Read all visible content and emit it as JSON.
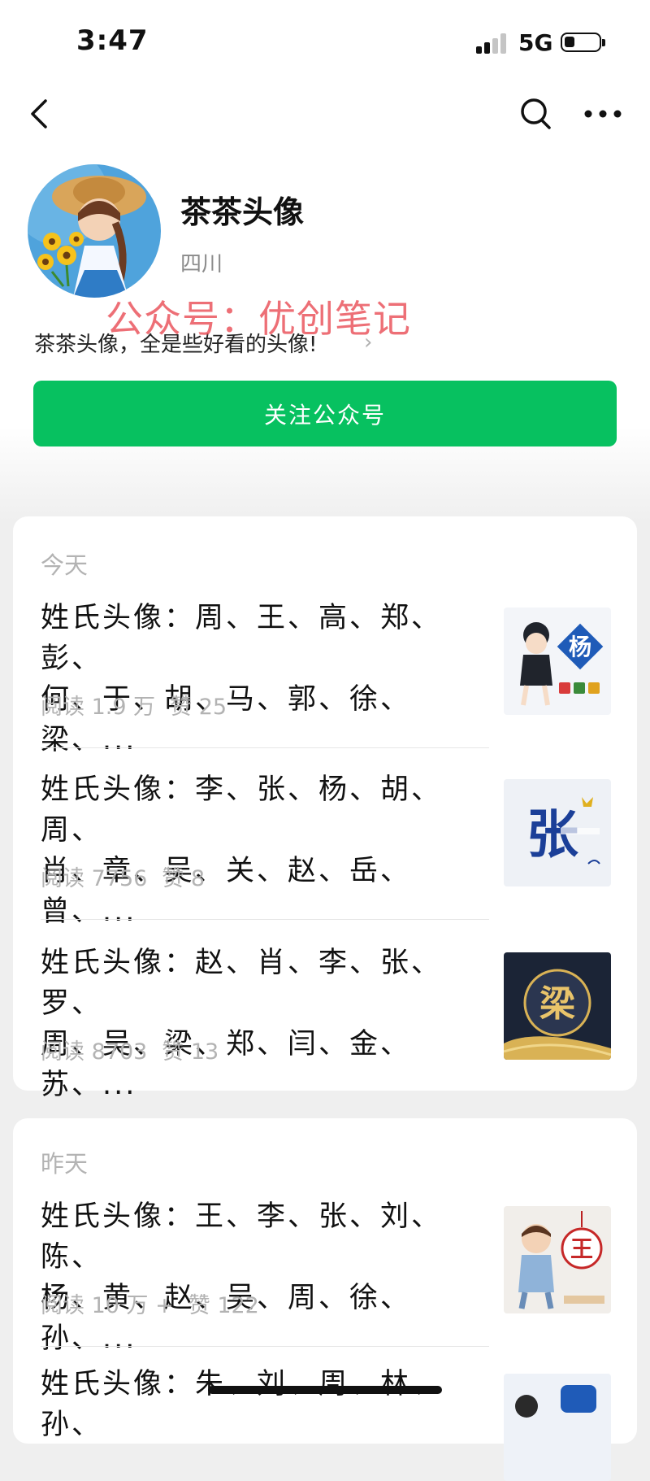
{
  "status_bar": {
    "time": "3:47",
    "network": "5G"
  },
  "nav": {
    "back_icon": "chevron-left-icon",
    "search_icon": "search-icon",
    "more_icon": "more-dots-icon"
  },
  "account": {
    "name": "茶茶头像",
    "location": "四川",
    "description": "茶茶头像，全是些好看的头像!",
    "follow_label": "关注公众号",
    "watermark": "公众号：优创笔记"
  },
  "feed": {
    "groups": [
      {
        "day": "今天",
        "articles": [
          {
            "title": "姓氏头像：周、王、高、郑、彭、\n何、于、胡、马、郭、徐、梁、...",
            "reads": "阅读 1.9 万",
            "likes": "赞 25",
            "thumb_text": "杨"
          },
          {
            "title": "姓氏头像：李、张、杨、胡、周、\n肖、章、吴、关、赵、岳、曾、...",
            "reads": "阅读 7756",
            "likes": "赞 8",
            "thumb_text": "张"
          },
          {
            "title": "姓氏头像：赵、肖、李、张、罗、\n周、吴、梁、郑、闫、金、苏、...",
            "reads": "阅读 8703",
            "likes": "赞 13",
            "thumb_text": "梁"
          }
        ]
      },
      {
        "day": "昨天",
        "articles": [
          {
            "title": "姓氏头像：王、李、张、刘、陈、\n杨、黄、赵、吴、周、徐、孙、...",
            "reads": "阅读 10 万 +",
            "likes": "赞 122",
            "thumb_text": "王"
          },
          {
            "title": "姓氏头像：朱、刘、周、林、孙、",
            "reads": "",
            "likes": "",
            "thumb_text": ""
          }
        ]
      }
    ]
  },
  "colors": {
    "accent": "#07c160",
    "watermark": "#e84650",
    "muted": "#b3b3b3"
  }
}
